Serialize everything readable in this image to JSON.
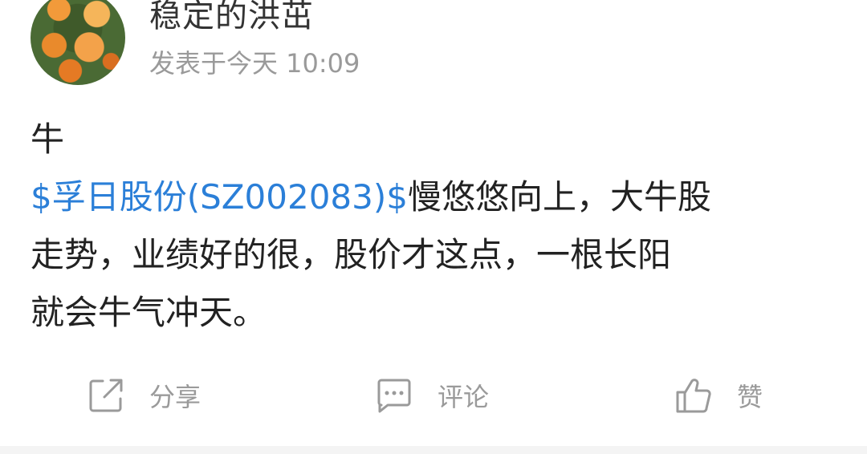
{
  "author": {
    "name": "稳定的洪茁",
    "posted": "发表于今天 10:09"
  },
  "post": {
    "title": "牛",
    "stock_tag": "$孚日股份(SZ002083)$",
    "body_line1_rest": "慢悠悠向上，大牛股",
    "body_line2": "走势，业绩好的很，股价才这点，一根长阳",
    "body_line3": "就会牛气冲天。"
  },
  "actions": {
    "share": "分享",
    "comment": "评论",
    "like": "赞"
  },
  "colors": {
    "link": "#2b7fd8",
    "muted": "#9a9a9a",
    "text": "#222222"
  },
  "icons": {
    "share": "share-icon",
    "comment": "comment-icon",
    "like": "thumbs-up-icon"
  }
}
